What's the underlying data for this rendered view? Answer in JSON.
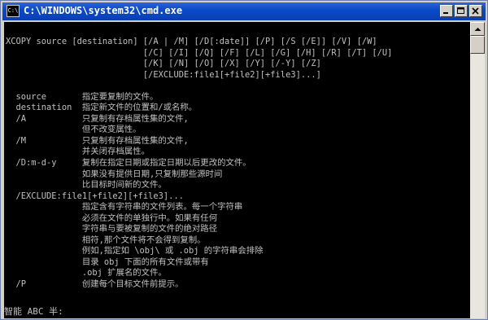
{
  "window": {
    "title": "C:\\WINDOWS\\system32\\cmd.exe",
    "icon_label": "C:\\",
    "controls": [
      "minimize-icon",
      "maximize-icon",
      "close-icon"
    ]
  },
  "console": {
    "lines": [
      "XCOPY source [destination] [/A | /M] [/D[:date]] [/P] [/S [/E]] [/V] [/W]",
      "                           [/C] [/I] [/Q] [/F] [/L] [/G] [/H] [/R] [/T] [/U]",
      "                           [/K] [/N] [/O] [/X] [/Y] [/-Y] [/Z]",
      "                           [/EXCLUDE:file1[+file2][+file3]...]",
      "",
      "  source       指定要复制的文件。",
      "  destination  指定新文件的位置和/或名称。",
      "  /A           只复制有存档属性集的文件,",
      "               但不改变属性。",
      "  /M           只复制有存档属性集的文件,",
      "               并关闭存档属性。",
      "  /D:m-d-y     复制在指定日期或指定日期以后更改的文件。",
      "               如果没有提供日期,只复制那些源时间",
      "               比目标时间新的文件。",
      "  /EXCLUDE:file1[+file2][+file3]...",
      "               指定含有字符串的文件列表。每一个字符串",
      "               必须在文件的单独行中。如果有任何",
      "               字符串与要被复制的文件的绝对路径",
      "               相符,那个文件将不会得到复制。",
      "               例如,指定如 \\obj\\ 或 .obj 的字符串会排除",
      "               目录 obj 下面的所有文件或带有",
      "               .obj 扩展名的文件。",
      "  /P           创建每个目标文件前提示。"
    ],
    "ime_status": "智能 ABC 半:"
  },
  "colors": {
    "titlebar": "#0b4ac9",
    "console_bg": "#000000",
    "console_fg": "#c0c0c0"
  }
}
